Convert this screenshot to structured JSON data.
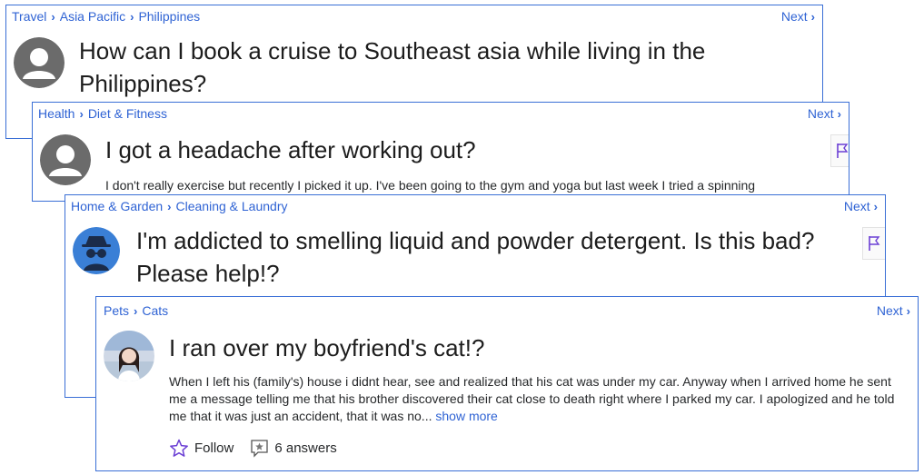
{
  "cards": [
    {
      "breadcrumb": [
        "Travel",
        "Asia Pacific",
        "Philippines"
      ],
      "next": "Next",
      "title": "How can I book a cruise to Southeast asia while living in the Philippines?"
    },
    {
      "breadcrumb": [
        "Health",
        "Diet & Fitness"
      ],
      "next": "Next",
      "title": "I got a headache after working out?",
      "body": "I don't really exercise but recently I picked it up. I've been going to the gym and yoga but last week I tried a spinning"
    },
    {
      "breadcrumb": [
        "Home & Garden",
        "Cleaning & Laundry"
      ],
      "next": "Next",
      "title": "I'm addicted to smelling liquid and powder detergent. Is this bad? Please help!?"
    },
    {
      "breadcrumb": [
        "Pets",
        "Cats"
      ],
      "next": "Next",
      "title": "I ran over my boyfriend's cat!?",
      "body": "When I left his (family's) house i didnt hear, see and realized that his cat was under my car. Anyway when I arrived home he sent me a message telling me that his brother discovered their cat close to death right where I parked my car. I apologized and he told me that it was just an accident, that it was no...",
      "show_more": "show more",
      "follow": "Follow",
      "answers": "6 answers"
    }
  ],
  "colors": {
    "link": "#2f63d4",
    "border": "#3a6fd6",
    "accent": "#6b3fd4"
  }
}
